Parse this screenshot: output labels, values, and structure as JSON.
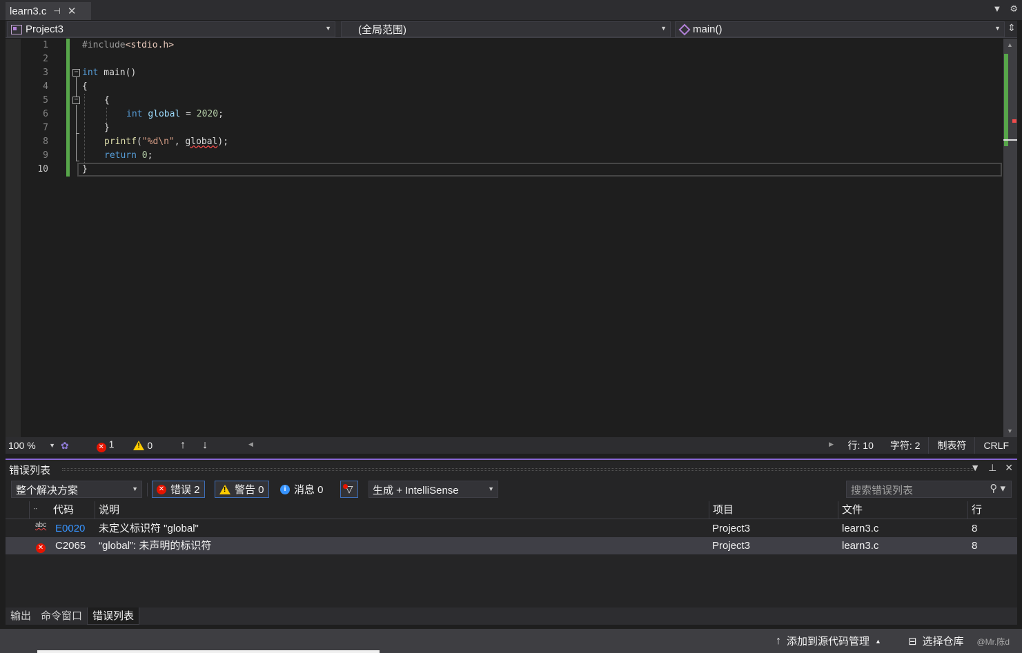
{
  "tab": {
    "title": "learn3.c",
    "pin": "⊣",
    "close": "✕",
    "dropdown": "▼",
    "settings": "⚙"
  },
  "navbar": {
    "project": "Project3",
    "scope": "(全局范围)",
    "member": "main()",
    "split": "⇕"
  },
  "editor": {
    "line_numbers": [
      "1",
      "2",
      "3",
      "4",
      "5",
      "6",
      "7",
      "8",
      "9",
      "10"
    ],
    "current_line": "10",
    "code": {
      "l1_directive": "#include",
      "l1_header": "<stdio.h>",
      "l3_kw": "int",
      "l3_rest": " main()",
      "l4": "{",
      "l5": "{",
      "l6_kw": "int",
      "l6_var": "global",
      "l6_op": " = ",
      "l6_num": "2020",
      "l6_end": ";",
      "l7": "}",
      "l8_fn": "printf",
      "l8_open": "(",
      "l8_str": "\"%d\\n\"",
      "l8_comma": ", ",
      "l8_err": "global",
      "l8_end": ");",
      "l9_kw": "return",
      "l9_num": "0",
      "l9_end": ";",
      "l10": "}"
    }
  },
  "editor_status": {
    "zoom": "100 %",
    "errors": "1",
    "warnings": "0",
    "line": "行: 10",
    "char": "字符: 2",
    "indent": "制表符",
    "eol": "CRLF"
  },
  "error_list": {
    "title": "错误列表",
    "scope": "整个解决方案",
    "errors_btn": "错误 2",
    "warnings_btn": "警告 0",
    "messages_btn": "消息 0",
    "build": "生成 + IntelliSense",
    "search_placeholder": "搜索错误列表",
    "columns": {
      "code": "代码",
      "desc": "说明",
      "project": "项目",
      "file": "文件",
      "line": "行"
    },
    "rows": [
      {
        "icon": "abc",
        "code": "E0020",
        "desc": "未定义标识符 \"global\"",
        "project": "Project3",
        "file": "learn3.c",
        "line": "8"
      },
      {
        "icon": "error",
        "code": "C2065",
        "desc": "“global”: 未声明的标识符",
        "project": "Project3",
        "file": "learn3.c",
        "line": "8"
      }
    ]
  },
  "bottom_tabs": [
    "输出",
    "命令窗口",
    "错误列表"
  ],
  "appstatus": {
    "source_control": "添加到源代码管理",
    "repo": "选择仓库",
    "watermark": "@Mr.陈d"
  },
  "colors": {
    "accent": "#8866d5",
    "error": "#e51400",
    "warning": "#ffcc00",
    "change": "#57a64a",
    "link": "#3794ff"
  }
}
